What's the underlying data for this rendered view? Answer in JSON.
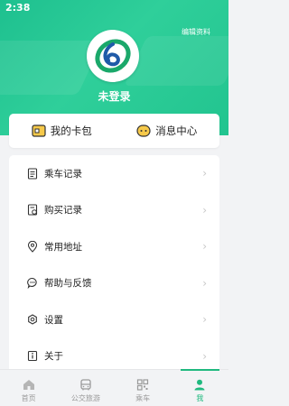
{
  "status_bar": {
    "time": "2:38"
  },
  "header": {
    "edit_profile": "编辑资料",
    "username": "未登录",
    "logo": "ring-6-logo"
  },
  "quick_actions": [
    {
      "label": "我的卡包",
      "icon": "card-wallet-icon"
    },
    {
      "label": "消息中心",
      "icon": "message-bubble-icon"
    }
  ],
  "menu": [
    {
      "label": "乘车记录",
      "icon": "document-icon"
    },
    {
      "label": "购买记录",
      "icon": "receipt-icon"
    },
    {
      "label": "常用地址",
      "icon": "location-pin-icon"
    },
    {
      "label": "帮助与反馈",
      "icon": "chat-bubble-icon"
    },
    {
      "label": "设置",
      "icon": "gear-icon"
    },
    {
      "label": "关于",
      "icon": "info-icon"
    }
  ],
  "bottom_nav": [
    {
      "label": "首页",
      "icon": "home-icon",
      "active": false
    },
    {
      "label": "公交旅游",
      "icon": "bus-icon",
      "active": false
    },
    {
      "label": "乘车",
      "icon": "qr-code-icon",
      "active": false
    },
    {
      "label": "我",
      "icon": "person-icon",
      "active": true
    }
  ],
  "colors": {
    "accent": "#20b97f",
    "header": "#2fcf9a",
    "chevron": "#c8c8c8"
  }
}
